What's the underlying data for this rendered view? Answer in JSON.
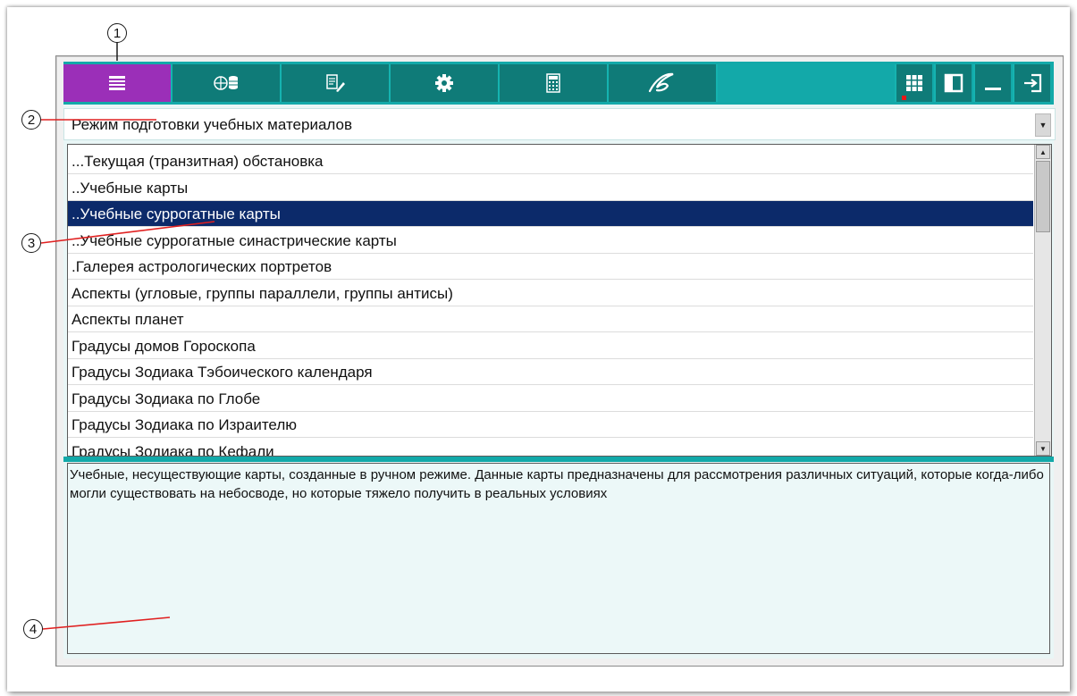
{
  "toolbar": {
    "tabs": [
      {
        "id": "list",
        "icon": "list-icon",
        "active": true
      },
      {
        "id": "globe-db",
        "icon": "globe-database-icon",
        "active": false
      },
      {
        "id": "book-pen",
        "icon": "book-edit-icon",
        "active": false
      },
      {
        "id": "settings",
        "icon": "gear-icon",
        "active": false
      },
      {
        "id": "calculator",
        "icon": "calculator-icon",
        "active": false
      },
      {
        "id": "signature",
        "icon": "signature-icon",
        "active": false
      }
    ],
    "right_buttons": [
      {
        "id": "grid",
        "icon": "grid-icon"
      },
      {
        "id": "panel",
        "icon": "panel-icon"
      },
      {
        "id": "minimize",
        "icon": "minimize-icon"
      },
      {
        "id": "exit",
        "icon": "exit-icon"
      }
    ],
    "colors": {
      "bar": "#13a9a9",
      "tab": "#0f7b78",
      "active": "#9b2fb8"
    }
  },
  "mode": {
    "selected": "Режим подготовки учебных материалов"
  },
  "list": {
    "items": [
      {
        "label": "...Текущая (транзитная) обстановка",
        "selected": false
      },
      {
        "label": "..Учебные карты",
        "selected": false
      },
      {
        "label": "..Учебные суррогатные карты",
        "selected": true
      },
      {
        "label": "..Учебные суррогатные синастрические карты",
        "selected": false
      },
      {
        "label": ".Галерея астрологических портретов",
        "selected": false
      },
      {
        "label": "Аспекты (угловые, группы параллели, группы антисы)",
        "selected": false
      },
      {
        "label": "Аспекты планет",
        "selected": false
      },
      {
        "label": "Градусы домов Гороскопа",
        "selected": false
      },
      {
        "label": "Градусы Зодиака Тэбоического календаря",
        "selected": false
      },
      {
        "label": "Градусы Зодиака по Глобе",
        "selected": false
      },
      {
        "label": "Градусы Зодиака по Израителю",
        "selected": false
      },
      {
        "label": "Градусы Зодиака по Кефали",
        "selected": false
      }
    ]
  },
  "description": {
    "text": "Учебные, несуществующие карты, созданные в ручном режиме. Данные карты предназначены для рассмотрения различных ситуаций, которые когда-либо могли существовать на небосводе, но которые тяжело получить в реальных условиях"
  },
  "callouts": [
    "1",
    "2",
    "3",
    "4"
  ]
}
